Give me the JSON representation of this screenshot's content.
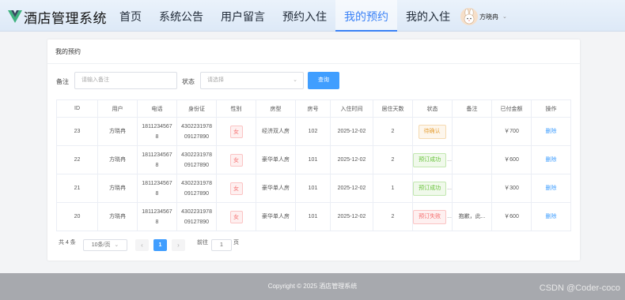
{
  "app": {
    "title": "酒店管理系统",
    "brand_color": "#3fb27f"
  },
  "nav": {
    "items": [
      {
        "label": "首页"
      },
      {
        "label": "系统公告"
      },
      {
        "label": "用户留言"
      },
      {
        "label": "预约入住"
      },
      {
        "label": "我的预约",
        "active": true
      },
      {
        "label": "我的入住"
      }
    ]
  },
  "user": {
    "name": "方晓冉",
    "caret": "⌄"
  },
  "card": {
    "title": "我的预约"
  },
  "search": {
    "note_label": "备注",
    "note_placeholder": "请输入备注",
    "status_label": "状态",
    "status_placeholder": "请选择",
    "button": "查询"
  },
  "table": {
    "columns": [
      "ID",
      "用户",
      "电话",
      "身份证",
      "性别",
      "房型",
      "房号",
      "入住时间",
      "居住天数",
      "状态",
      "备注",
      "已付金额",
      "操作"
    ],
    "rows": [
      {
        "id": "23",
        "user": "方晓冉",
        "phone_1": "1811234567",
        "phone_2": "8",
        "idcard_1": "4302231978",
        "idcard_2": "09127890",
        "gender": "女",
        "room_type": "经济双人房",
        "room_no": "102",
        "date": "2025-12-02",
        "days": "2",
        "status": "待确认",
        "status_type": "warning",
        "status_ellipsis": "",
        "note": "",
        "amount": "￥700",
        "action": "删除"
      },
      {
        "id": "22",
        "user": "方晓冉",
        "phone_1": "1811234567",
        "phone_2": "8",
        "idcard_1": "4302231978",
        "idcard_2": "09127890",
        "gender": "女",
        "room_type": "豪华单人房",
        "room_no": "101",
        "date": "2025-12-02",
        "days": "2",
        "status": "预订成功",
        "status_type": "success",
        "status_ellipsis": "...",
        "note": "",
        "amount": "￥600",
        "action": "删除"
      },
      {
        "id": "21",
        "user": "方晓冉",
        "phone_1": "1811234567",
        "phone_2": "8",
        "idcard_1": "4302231978",
        "idcard_2": "09127890",
        "gender": "女",
        "room_type": "豪华单人房",
        "room_no": "101",
        "date": "2025-12-02",
        "days": "1",
        "status": "预订成功",
        "status_type": "success",
        "status_ellipsis": "...",
        "note": "",
        "amount": "￥300",
        "action": "删除"
      },
      {
        "id": "20",
        "user": "方晓冉",
        "phone_1": "1811234567",
        "phone_2": "8",
        "idcard_1": "4302231978",
        "idcard_2": "09127890",
        "gender": "女",
        "room_type": "豪华单人房",
        "room_no": "101",
        "date": "2025-12-02",
        "days": "2",
        "status": "预订失败",
        "status_type": "danger",
        "status_ellipsis": "...",
        "note": "抱歉，此...",
        "amount": "￥600",
        "action": "删除"
      }
    ]
  },
  "pagination": {
    "total": "共 4 条",
    "page_size": "10条/页",
    "prev": "‹",
    "current": "1",
    "next": "›",
    "goto_label": "前往",
    "goto_value": "1",
    "goto_suffix": "页"
  },
  "footer": {
    "copyright": "Copyright © 2025 酒店管理系统"
  },
  "watermark": "CSDN @Coder-coco"
}
